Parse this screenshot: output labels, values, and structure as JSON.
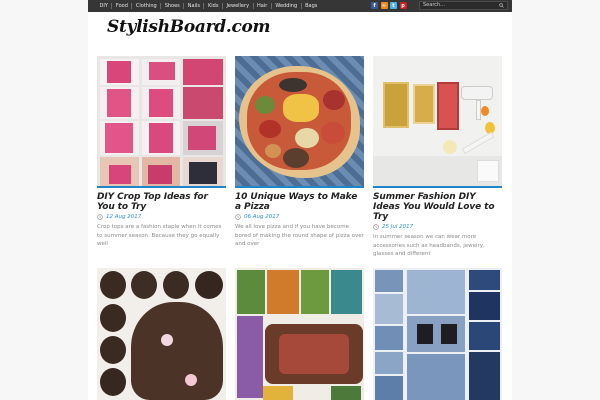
{
  "nav": {
    "items": [
      "DIY",
      "Food",
      "Clothing",
      "Shoes",
      "Nails",
      "Kids",
      "Jewellery",
      "Hair",
      "Wedding",
      "Bags"
    ],
    "social": [
      {
        "icon": "facebook-icon",
        "glyph": "f",
        "color": "#3b5998"
      },
      {
        "icon": "rss-icon",
        "glyph": "≈",
        "color": "#f18a1c"
      },
      {
        "icon": "twitter-icon",
        "glyph": "t",
        "color": "#4ab3e5"
      },
      {
        "icon": "pinterest-icon",
        "glyph": "p",
        "color": "#cb2027"
      }
    ],
    "search_placeholder": "Search..."
  },
  "logo": "StylishBoard.com",
  "posts": [
    {
      "title": "DIY Crop Top Ideas for You to Try",
      "date": "12 Aug 2017",
      "excerpt": "Crop tops are a fashion staple when it comes to summer season. Because they go equally well"
    },
    {
      "title": "10 Unique Ways to Make a Pizza",
      "date": "06 Aug 2017",
      "excerpt": "We all love pizza and if you have become bored of making the round shape of pizza over and over"
    },
    {
      "title": "Summer Fashion DIY Ideas You Would Love to Try",
      "date": "25 Jul 2017",
      "excerpt": "In summer season we can wear more accessories such as headbands, jewelry, glasses and different"
    }
  ],
  "colors": {
    "accent": "#1f86c9",
    "date": "#2b8bd6",
    "topbar": "#363636"
  }
}
